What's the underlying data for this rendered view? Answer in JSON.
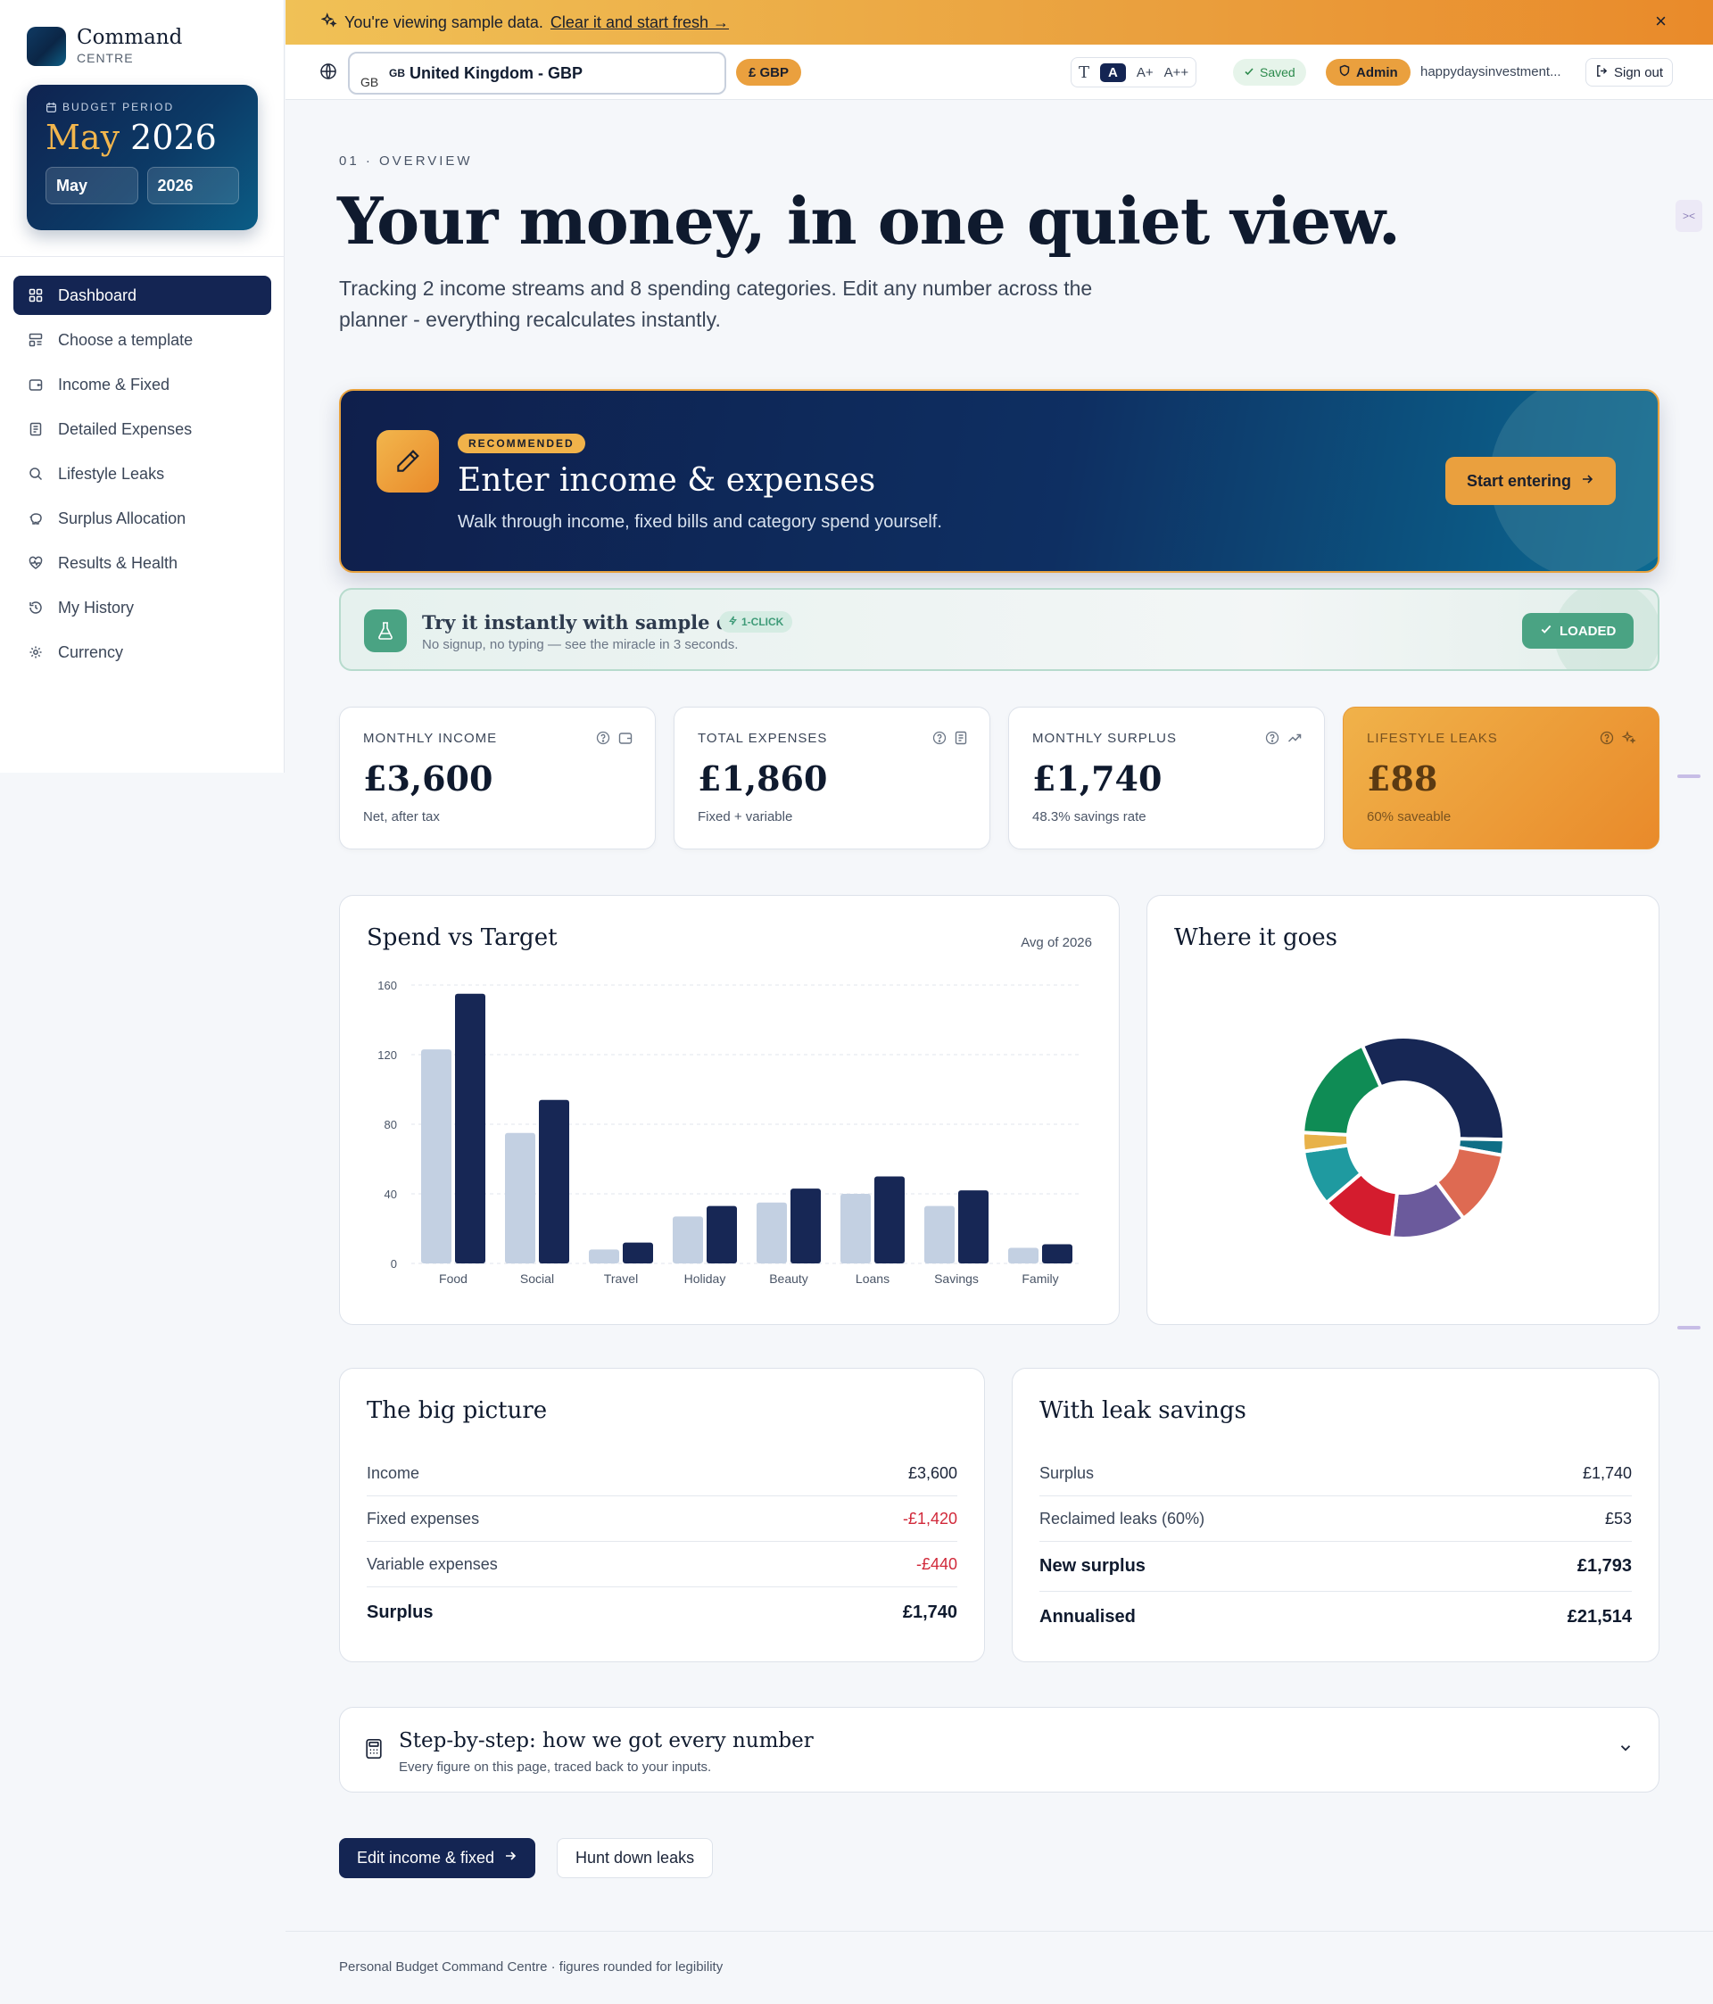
{
  "brand": {
    "name": "Command",
    "sub": "CENTRE"
  },
  "budget_period": {
    "label": "BUDGET PERIOD",
    "month": "May",
    "year": "2026",
    "month_select": "May",
    "year_select": "2026"
  },
  "sidebar": {
    "items": [
      {
        "label": "Dashboard",
        "icon": "grid-icon",
        "active": true
      },
      {
        "label": "Choose a template",
        "icon": "template-icon"
      },
      {
        "label": "Income & Fixed",
        "icon": "wallet-icon"
      },
      {
        "label": "Detailed Expenses",
        "icon": "receipt-icon"
      },
      {
        "label": "Lifestyle Leaks",
        "icon": "search-icon"
      },
      {
        "label": "Surplus Allocation",
        "icon": "piggy-bank-icon"
      },
      {
        "label": "Results & Health",
        "icon": "heart-pulse-icon"
      },
      {
        "label": "My History",
        "icon": "history-icon"
      },
      {
        "label": "Currency",
        "icon": "gear-icon"
      }
    ]
  },
  "banner": {
    "text": "You're viewing sample data.",
    "link": "Clear it and start fresh →",
    "close": "×"
  },
  "topbar": {
    "country_flag": "GB",
    "country_value": "United Kingdom - GBP",
    "currency_pill": "£ GBP",
    "text_sizes": [
      "A",
      "A+",
      "A++"
    ],
    "saved": "Saved",
    "admin": "Admin",
    "user": "happydaysinvestment...",
    "sign_out": "Sign out"
  },
  "hero": {
    "eyebrow": "01 · OVERVIEW",
    "title": "Your money, in one quiet view.",
    "subtitle": "Tracking 2 income streams and 8 spending categories. Edit any number across the planner - everything recalculates instantly."
  },
  "recommended": {
    "badge": "RECOMMENDED",
    "title": "Enter income & expenses",
    "desc": "Walk through income, fixed bills and category spend yourself.",
    "button": "Start entering"
  },
  "sample": {
    "title": "Try it instantly with sample data",
    "badge": "1-CLICK",
    "sub": "No signup, no typing — see the miracle in 3 seconds.",
    "button": "LOADED"
  },
  "stats": [
    {
      "label": "MONTHLY INCOME",
      "value": "£3,600",
      "sub": "Net, after tax"
    },
    {
      "label": "TOTAL EXPENSES",
      "value": "£1,860",
      "sub": "Fixed + variable"
    },
    {
      "label": "MONTHLY SURPLUS",
      "value": "£1,740",
      "sub": "48.3% savings rate"
    },
    {
      "label": "LIFESTYLE LEAKS",
      "value": "£88",
      "sub": "60% saveable"
    }
  ],
  "spend_panel": {
    "title": "Spend vs Target",
    "note": "Avg of 2026"
  },
  "donut_panel": {
    "title": "Where it goes"
  },
  "chart_data": [
    {
      "type": "bar",
      "title": "Spend vs Target",
      "categories": [
        "Food",
        "Social",
        "Travel",
        "Holiday",
        "Beauty",
        "Loans",
        "Savings",
        "Family"
      ],
      "series": [
        {
          "values": [
            123,
            75,
            8,
            27,
            35,
            40,
            33,
            9
          ],
          "color": "#c3d0e2"
        },
        {
          "values": [
            155,
            94,
            12,
            33,
            43,
            50,
            42,
            11
          ],
          "color": "#172755"
        }
      ],
      "yticks": [
        0,
        40,
        80,
        120,
        160
      ],
      "ylim": [
        0,
        160
      ],
      "grid": true
    },
    {
      "type": "pie",
      "title": "Where it goes",
      "donut": true,
      "slices": [
        {
          "value": 32,
          "color": "#172755"
        },
        {
          "value": 2.5,
          "color": "#0f6e86"
        },
        {
          "value": 12,
          "color": "#de6a52"
        },
        {
          "value": 12,
          "color": "#6b5a9c"
        },
        {
          "value": 12,
          "color": "#d41c2e"
        },
        {
          "value": 9,
          "color": "#1f9aa0"
        },
        {
          "value": 3,
          "color": "#e8b24a"
        },
        {
          "value": 17.5,
          "color": "#0f8c55"
        }
      ]
    }
  ],
  "big_picture": {
    "title": "The big picture",
    "rows": [
      {
        "label": "Income",
        "value": "£3,600"
      },
      {
        "label": "Fixed expenses",
        "value": "-£1,420"
      },
      {
        "label": "Variable expenses",
        "value": "-£440"
      }
    ],
    "total": {
      "label": "Surplus",
      "value": "£1,740"
    }
  },
  "leak_savings": {
    "title": "With leak savings",
    "rows": [
      {
        "label": "Surplus",
        "value": "£1,740"
      },
      {
        "label": "Reclaimed leaks (60%)",
        "value": "£53"
      }
    ],
    "new_surplus": {
      "label": "New surplus",
      "value": "£1,793"
    },
    "annualised": {
      "label": "Annualised",
      "value": "£21,514"
    }
  },
  "steps": {
    "title": "Step-by-step: how we got every number",
    "sub": "Every figure on this page, traced back to your inputs."
  },
  "actions": {
    "primary": "Edit income & fixed",
    "secondary": "Hunt down leaks"
  },
  "footer": "Personal Budget Command Centre · figures rounded for legibility",
  "colors": {
    "navy": "#142553",
    "amber": "#eaa03e",
    "green": "#4aa383",
    "negative": "#d1293a"
  }
}
